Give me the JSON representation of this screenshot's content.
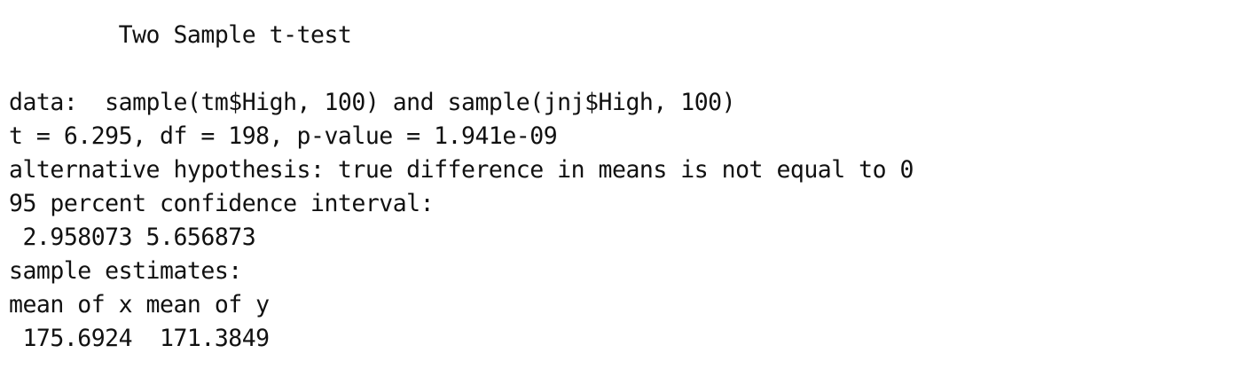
{
  "console_output": {
    "title": "        Two Sample t-test",
    "blank_1": "",
    "data_line": "data:  sample(tm$High, 100) and sample(jnj$High, 100)",
    "stats_line": "t = 6.295, df = 198, p-value = 1.941e-09",
    "alternative_line": "alternative hypothesis: true difference in means is not equal to 0",
    "ci_header": "95 percent confidence interval:",
    "ci_values": " 2.958073 5.656873",
    "estimates_header": "sample estimates:",
    "estimates_labels": "mean of x mean of y",
    "estimates_values": " 175.6924  171.3849"
  }
}
